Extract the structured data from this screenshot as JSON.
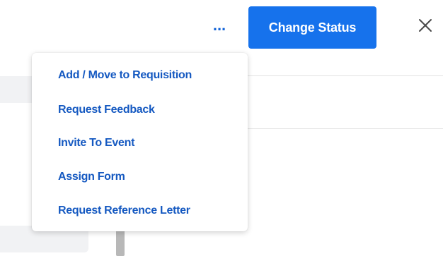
{
  "header": {
    "more_label": "...",
    "change_status_label": "Change Status",
    "close_icon": "close-icon"
  },
  "menu": {
    "items": [
      {
        "label": "Add / Move to Requisition"
      },
      {
        "label": "Request Feedback"
      },
      {
        "label": "Invite To Event"
      },
      {
        "label": "Assign Form"
      },
      {
        "label": "Request Reference Letter"
      }
    ]
  },
  "colors": {
    "accent": "#1672ec",
    "menu_text": "#1559c1",
    "divider": "#e3e3e3"
  }
}
